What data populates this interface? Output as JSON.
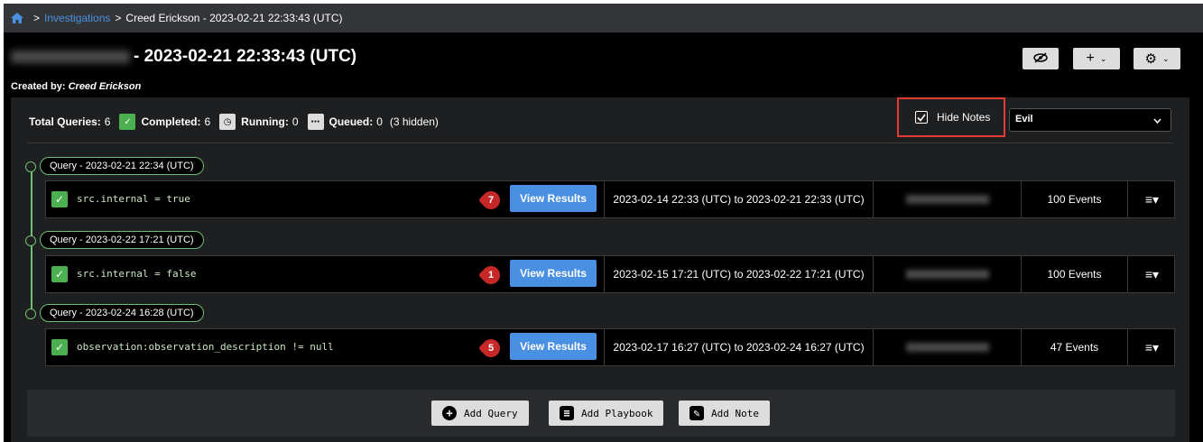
{
  "breadcrumb": {
    "home_icon": "home-icon",
    "sep1": ">",
    "investigations": "Investigations",
    "sep2": ">",
    "current": "Creed Erickson - 2023-02-21 22:33:43 (UTC)"
  },
  "header": {
    "title_suffix": "- 2023-02-21 22:33:43 (UTC)",
    "created_label": "Created by:",
    "created_by": "Creed Erickson",
    "buttons": {
      "hide_icon": "eye-slash-icon",
      "add_label": "+",
      "settings_icon": "gear-icon"
    }
  },
  "stats": {
    "total_label": "Total Queries:",
    "total_value": "6",
    "completed_label": "Completed:",
    "completed_value": "6",
    "running_label": "Running:",
    "running_value": "0",
    "queued_label": "Queued:",
    "queued_value": "0",
    "hidden_text": "(3 hidden)"
  },
  "hide_notes": {
    "label": "Hide Notes",
    "checked": true
  },
  "select": {
    "value": "Evil"
  },
  "queries": [
    {
      "label": "Query - 2023-02-21 22:34 (UTC)",
      "code": "src.internal = true",
      "badge": "7",
      "view_label": "View Results",
      "range": "2023-02-14 22:33 (UTC) to 2023-02-21 22:33 (UTC)",
      "events": "100 Events"
    },
    {
      "label": "Query - 2023-02-22 17:21 (UTC)",
      "code": "src.internal = false",
      "badge": "1",
      "view_label": "View Results",
      "range": "2023-02-15 17:21 (UTC) to 2023-02-22 17:21 (UTC)",
      "events": "100 Events"
    },
    {
      "label": "Query - 2023-02-24 16:28 (UTC)",
      "code": "observation:observation_description != null",
      "badge": "5",
      "view_label": "View Results",
      "range": "2023-02-17 16:27 (UTC) to 2023-02-24 16:27 (UTC)",
      "events": "47 Events"
    }
  ],
  "footer": {
    "add_query": "Add Query",
    "add_playbook": "Add Playbook",
    "add_note": "Add Note"
  },
  "colors": {
    "accent": "#4a90e2",
    "success": "#4caf50",
    "badge": "#c62828",
    "highlight": "#e53935"
  }
}
